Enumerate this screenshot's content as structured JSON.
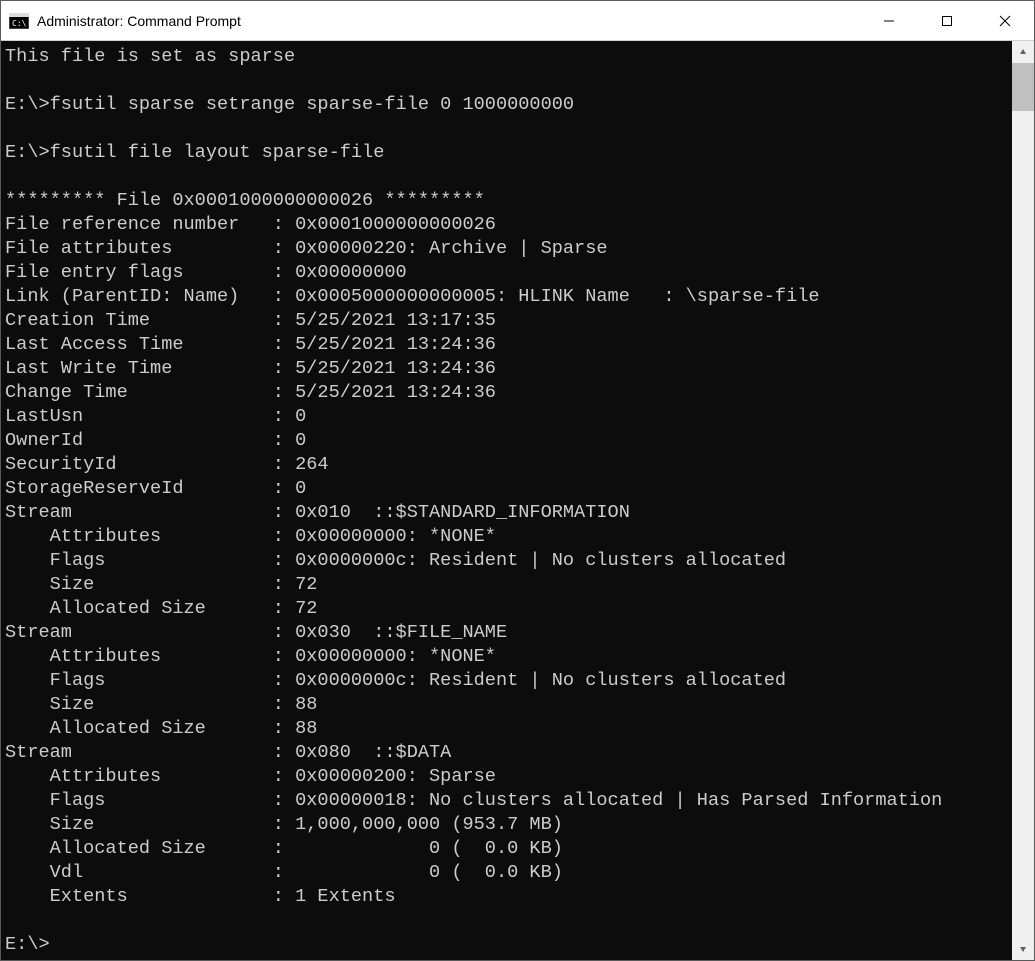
{
  "window": {
    "title": "Administrator: Command Prompt"
  },
  "terminal": {
    "lines": [
      "This file is set as sparse",
      "",
      "E:\\>fsutil sparse setrange sparse-file 0 1000000000",
      "",
      "E:\\>fsutil file layout sparse-file",
      "",
      "********* File 0x0001000000000026 *********",
      "File reference number   : 0x0001000000000026",
      "File attributes         : 0x00000220: Archive | Sparse",
      "File entry flags        : 0x00000000",
      "Link (ParentID: Name)   : 0x0005000000000005: HLINK Name   : \\sparse-file",
      "Creation Time           : 5/25/2021 13:17:35",
      "Last Access Time        : 5/25/2021 13:24:36",
      "Last Write Time         : 5/25/2021 13:24:36",
      "Change Time             : 5/25/2021 13:24:36",
      "LastUsn                 : 0",
      "OwnerId                 : 0",
      "SecurityId              : 264",
      "StorageReserveId        : 0",
      "Stream                  : 0x010  ::$STANDARD_INFORMATION",
      "    Attributes          : 0x00000000: *NONE*",
      "    Flags               : 0x0000000c: Resident | No clusters allocated",
      "    Size                : 72",
      "    Allocated Size      : 72",
      "Stream                  : 0x030  ::$FILE_NAME",
      "    Attributes          : 0x00000000: *NONE*",
      "    Flags               : 0x0000000c: Resident | No clusters allocated",
      "    Size                : 88",
      "    Allocated Size      : 88",
      "Stream                  : 0x080  ::$DATA",
      "    Attributes          : 0x00000200: Sparse",
      "    Flags               : 0x00000018: No clusters allocated | Has Parsed Information",
      "    Size                : 1,000,000,000 (953.7 MB)",
      "    Allocated Size      :             0 (  0.0 KB)",
      "    Vdl                 :             0 (  0.0 KB)",
      "    Extents             : 1 Extents",
      "",
      "E:\\>"
    ]
  }
}
